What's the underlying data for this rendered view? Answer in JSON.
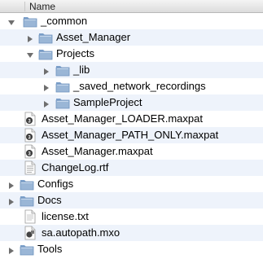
{
  "header": {
    "name_label": "Name"
  },
  "rows": [
    {
      "label": "_common",
      "type": "folder",
      "expanded": true,
      "depth": 0
    },
    {
      "label": "Asset_Manager",
      "type": "folder",
      "expanded": false,
      "depth": 1
    },
    {
      "label": "Projects",
      "type": "folder",
      "expanded": true,
      "depth": 1
    },
    {
      "label": "_lib",
      "type": "folder",
      "expanded": false,
      "depth": 2
    },
    {
      "label": "_saved_network_recordings",
      "type": "folder",
      "expanded": false,
      "depth": 2
    },
    {
      "label": "SampleProject",
      "type": "folder",
      "expanded": false,
      "depth": 2
    },
    {
      "label": "Asset_Manager_LOADER.maxpat",
      "type": "maxpat",
      "depth": 0
    },
    {
      "label": "Asset_Manager_PATH_ONLY.maxpat",
      "type": "maxpat",
      "depth": 0
    },
    {
      "label": "Asset_Manager.maxpat",
      "type": "maxpat",
      "depth": 0
    },
    {
      "label": "ChangeLog.rtf",
      "type": "rtf",
      "depth": 0
    },
    {
      "label": "Configs",
      "type": "folder",
      "expanded": false,
      "depth": -1
    },
    {
      "label": "Docs",
      "type": "folder",
      "expanded": false,
      "depth": -1
    },
    {
      "label": "license.txt",
      "type": "txt",
      "depth": 0
    },
    {
      "label": "sa.autopath.mxo",
      "type": "mxo",
      "depth": 0
    },
    {
      "label": "Tools",
      "type": "folder",
      "expanded": false,
      "depth": -1
    }
  ],
  "icons": {
    "folder": "folder-icon",
    "maxpat": "maxpat-document-icon",
    "rtf": "rtf-document-icon",
    "txt": "text-document-icon",
    "mxo": "mxo-external-icon",
    "expanded": "disclosure-triangle-down-icon",
    "collapsed": "disclosure-triangle-right-icon"
  },
  "colors": {
    "folder": "#9ab6d6",
    "stripe": "#eef3fb",
    "triangle": "#6e6e6e"
  }
}
